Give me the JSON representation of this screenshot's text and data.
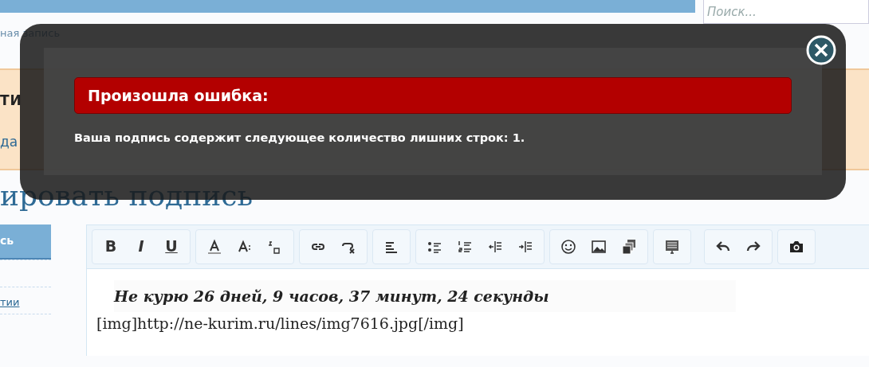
{
  "search": {
    "placeholder": "Поиск..."
  },
  "breadcrumb": "ная запись",
  "banner": {
    "title": "ТИ",
    "text": "да"
  },
  "heading": "ировать подпись",
  "sidebar": {
    "tab": "сь",
    "link": "тии"
  },
  "editor": {
    "format_buttons": [
      "B",
      "I",
      "U"
    ],
    "signature_text": "Не курю  26 дней, 9 часов, 37 минут, 24 секунды",
    "content": "[img]http://ne-kurim.ru/lines/img7616.jpg[/img]"
  },
  "dialog": {
    "title": "Произошла ошибка:",
    "message": "Ваша подпись содержит следующее количество лишних строк: 1."
  }
}
